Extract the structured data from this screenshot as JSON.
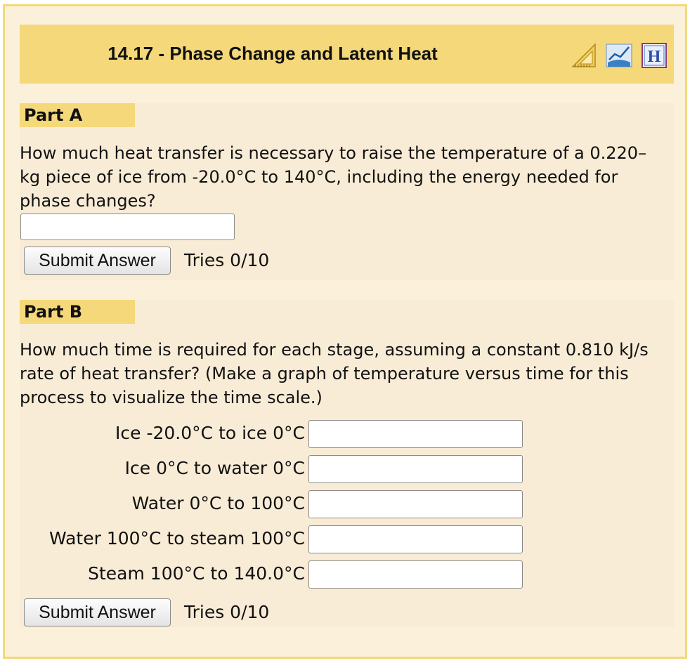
{
  "header": {
    "title": "14.17 - Phase Change and Latent Heat",
    "icons": [
      "triangle-ruler-icon",
      "graph-book-icon",
      "hint-h-icon"
    ]
  },
  "part_a": {
    "label": "Part A",
    "question": "How much heat transfer is necessary to raise the temperature of a 0.220–kg piece of ice from -20.0°C to 140°C, including the energy needed for phase changes?",
    "input_value": "",
    "submit_label": "Submit Answer",
    "tries": "Tries 0/10"
  },
  "part_b": {
    "label": "Part B",
    "question": "How much time is required for each stage, assuming a constant 0.810 kJ/s rate of heat transfer? (Make a graph of temperature versus time for this process to visualize the time scale.)",
    "rows": [
      {
        "label": "Ice -20.0°C to ice 0°C",
        "value": ""
      },
      {
        "label": "Ice 0°C to water 0°C",
        "value": ""
      },
      {
        "label": "Water 0°C to 100°C",
        "value": ""
      },
      {
        "label": "Water 100°C to steam 100°C",
        "value": ""
      },
      {
        "label": "Steam 100°C to 140.0°C",
        "value": ""
      }
    ],
    "submit_label": "Submit Answer",
    "tries": "Tries 0/10"
  },
  "colors": {
    "header_bg": "#f5d87a",
    "panel_bg": "#fbf0d9",
    "part_bg": "#f9ecd6",
    "border": "#f2d97a"
  }
}
